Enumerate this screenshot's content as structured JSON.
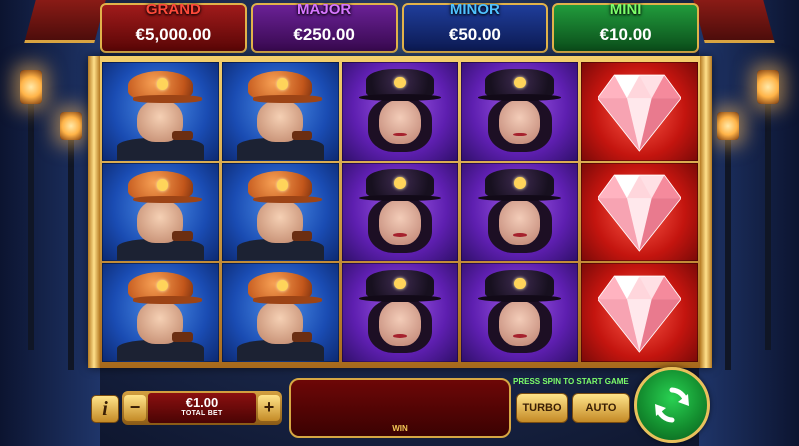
{
  "jackpots": [
    {
      "label": "GRAND",
      "value": "€5,000.00"
    },
    {
      "label": "MAJOR",
      "value": "€250.00"
    },
    {
      "label": "MINOR",
      "value": "€50.00"
    },
    {
      "label": "MINI",
      "value": "€10.00"
    }
  ],
  "reels": [
    {
      "symbols": [
        "detective",
        "detective",
        "detective"
      ]
    },
    {
      "symbols": [
        "detective",
        "detective",
        "detective"
      ]
    },
    {
      "symbols": [
        "lady",
        "lady",
        "lady"
      ]
    },
    {
      "symbols": [
        "lady",
        "lady",
        "lady"
      ]
    },
    {
      "symbols": [
        "diamond",
        "diamond",
        "diamond"
      ]
    }
  ],
  "controls": {
    "info": "i",
    "bet_value": "€1.00",
    "bet_label": "TOTAL BET",
    "minus": "−",
    "plus": "+",
    "win_label": "WIN",
    "hint": "PRESS SPIN TO START GAME",
    "turbo": "TURBO",
    "auto": "AUTO"
  },
  "icons": {
    "info": "info-icon",
    "spin": "refresh-arrows-icon",
    "diamond": "diamond-icon"
  }
}
